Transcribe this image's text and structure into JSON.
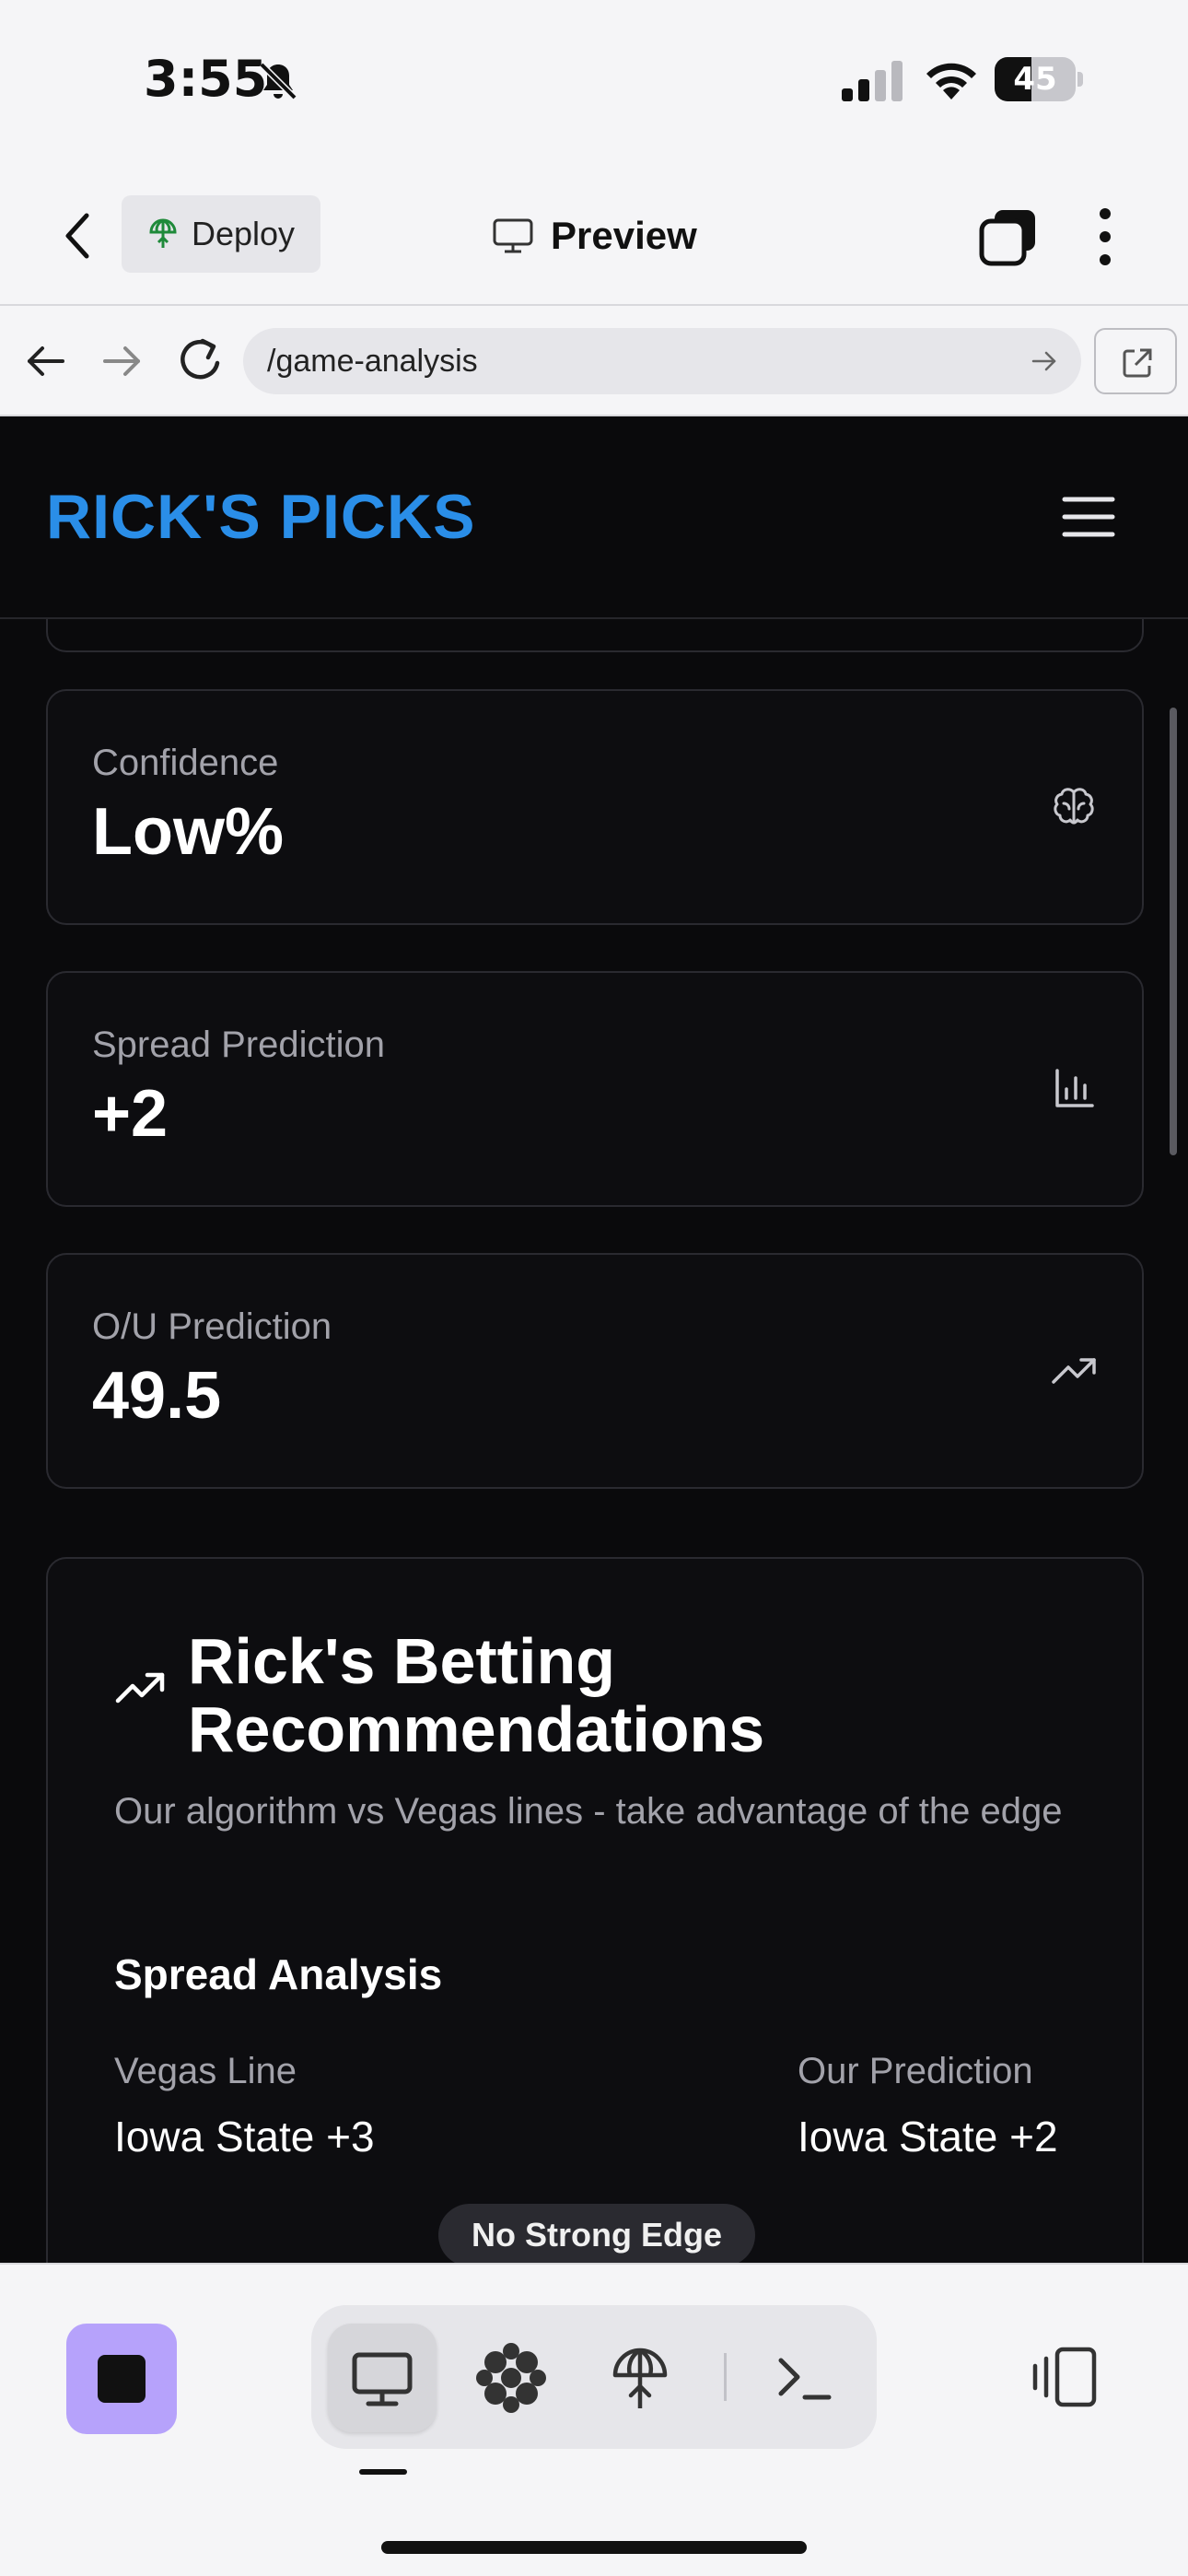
{
  "status_bar": {
    "time": "3:55",
    "battery": "45",
    "battery_level": 0.45
  },
  "app_toolbar": {
    "deploy_label": "Deploy",
    "preview_label": "Preview"
  },
  "browser": {
    "url": "/game-analysis"
  },
  "site": {
    "logo": "RICK'S PICKS"
  },
  "stats": [
    {
      "label": "Confidence",
      "value": "Low%",
      "icon": "brain-icon"
    },
    {
      "label": "Spread Prediction",
      "value": "+2",
      "icon": "bar-chart-icon"
    },
    {
      "label": "O/U Prediction",
      "value": "49.5",
      "icon": "trending-up-icon"
    }
  ],
  "recommendations": {
    "title": "Rick's Betting Recommendations",
    "subtitle": "Our algorithm vs Vegas lines - take advantage of the edge",
    "spread_heading": "Spread Analysis",
    "vegas_label": "Vegas Line",
    "vegas_value": "Iowa State +3",
    "our_label": "Our Prediction",
    "our_value": "Iowa State +2",
    "edge_badge": "No Strong Edge"
  },
  "bottom_bar": {
    "modes": [
      "preview-desktop-icon",
      "grid-blobs-icon",
      "deploy-icon",
      "terminal-icon"
    ],
    "active_mode": "preview-desktop-icon"
  },
  "colors": {
    "brand_blue": "#2a8ee8",
    "stop_button": "#b6a2fb",
    "page_bg": "#0a0a0c",
    "card_border": "#2a2a30"
  }
}
